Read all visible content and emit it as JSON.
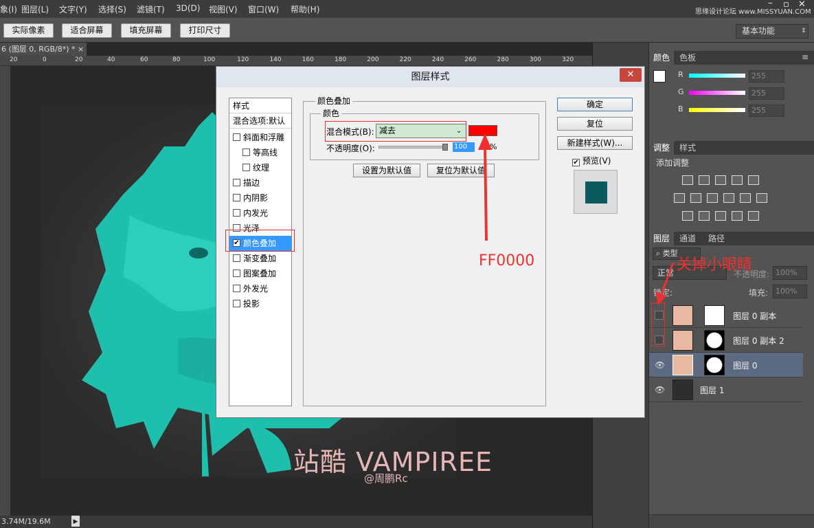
{
  "menubar": {
    "items": [
      "象(I)",
      "图层(L)",
      "文字(Y)",
      "选择(S)",
      "滤镜(T)",
      "3D(D)",
      "视图(V)",
      "窗口(W)",
      "帮助(H)"
    ],
    "site_watermark": "思缘设计论坛 www.MISSYUAN.COM"
  },
  "options": {
    "buttons": [
      "实际像素",
      "适合屏幕",
      "填充屏幕",
      "打印尺寸"
    ],
    "workspace": "基本功能"
  },
  "document": {
    "tab_label": "6 (图层 0, RGB/8*) *",
    "tab_close": "×",
    "ruler_ticks": [
      "20",
      "0",
      "20",
      "40",
      "60",
      "80",
      "100",
      "120",
      "140",
      "160",
      "180",
      "200",
      "220",
      "240",
      "260",
      "280",
      "300",
      "320"
    ],
    "status": "3.74M/19.6M"
  },
  "artwork": {
    "title": "站酷 VAMPIREE",
    "author": "@周鹏Rc"
  },
  "color_panel": {
    "tabs": [
      "颜色",
      "色板"
    ],
    "sliders": [
      {
        "label": "R",
        "value": "255"
      },
      {
        "label": "G",
        "value": "255"
      },
      {
        "label": "B",
        "value": "255"
      }
    ]
  },
  "adjust_panel": {
    "tabs": [
      "调整",
      "样式"
    ],
    "heading": "添加调整"
  },
  "layers_panel": {
    "tabs": [
      "图层",
      "通道",
      "路径"
    ],
    "filter": "类型",
    "blend": "正常",
    "opacity_label": "不透明度:",
    "opacity": "100%",
    "lock_label": "锁定:",
    "fill_label": "填充:",
    "fill": "100%",
    "layers": [
      {
        "name": "图层 0 副本",
        "visible": false
      },
      {
        "name": "图层 0 副本 2",
        "visible": false
      },
      {
        "name": "图层 0",
        "visible": true,
        "selected": true
      },
      {
        "name": "图层 1",
        "visible": true
      }
    ]
  },
  "dialog": {
    "title": "图层样式",
    "close": "✕",
    "style_list": {
      "header": "样式",
      "blend_options": "混合选项:默认",
      "items": [
        {
          "label": "斜面和浮雕",
          "checked": false,
          "indent": false
        },
        {
          "label": "等高线",
          "checked": false,
          "indent": true
        },
        {
          "label": "纹理",
          "checked": false,
          "indent": true
        },
        {
          "label": "描边",
          "checked": false,
          "indent": false
        },
        {
          "label": "内阴影",
          "checked": false,
          "indent": false
        },
        {
          "label": "内发光",
          "checked": false,
          "indent": false
        },
        {
          "label": "光泽",
          "checked": false,
          "indent": false
        },
        {
          "label": "颜色叠加",
          "checked": true,
          "indent": false,
          "selected": true
        },
        {
          "label": "渐变叠加",
          "checked": false,
          "indent": false
        },
        {
          "label": "图案叠加",
          "checked": false,
          "indent": false
        },
        {
          "label": "外发光",
          "checked": false,
          "indent": false
        },
        {
          "label": "投影",
          "checked": false,
          "indent": false
        }
      ]
    },
    "section_title": "颜色叠加",
    "group_title": "颜色",
    "blend_label": "混合模式(B):",
    "blend_value": "减去",
    "overlay_color": "#ff0000",
    "opacity_label": "不透明度(O):",
    "opacity_value": "100",
    "opacity_unit": "%",
    "set_default": "设置为默认值",
    "reset_default": "复位为默认值",
    "ok": "确定",
    "reset": "复位",
    "new_style": "新建样式(W)...",
    "preview_label": "预览(V)",
    "preview_checked": true
  },
  "annotations": {
    "color_note": "FF0000",
    "eye_note": "关掉小眼睛"
  }
}
